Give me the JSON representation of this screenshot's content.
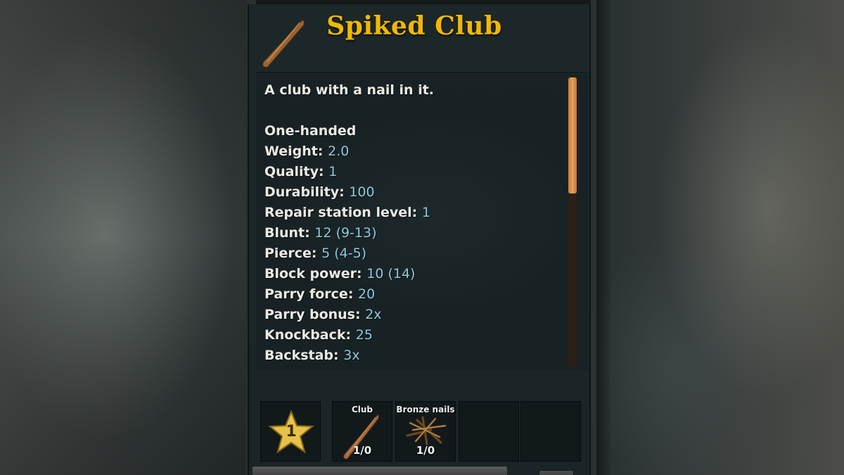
{
  "item": {
    "title": "Spiked Club",
    "icon": "club-icon"
  },
  "tooltip": {
    "description": "A club with a nail in it.",
    "handedness": "One-handed",
    "stats": [
      {
        "label": "Weight:",
        "value": "2.0"
      },
      {
        "label": "Quality:",
        "value": "1"
      },
      {
        "label": "Durability:",
        "value": "100"
      },
      {
        "label": "Repair station level:",
        "value": "1"
      },
      {
        "label": "Blunt:",
        "value": "12 (9-13)"
      },
      {
        "label": "Pierce:",
        "value": "5 (4-5)"
      },
      {
        "label": "Block power:",
        "value": "10 (14)"
      },
      {
        "label": "Parry force:",
        "value": "20"
      },
      {
        "label": "Parry bonus:",
        "value": "2x"
      },
      {
        "label": "Knockback:",
        "value": "25"
      },
      {
        "label": "Backstab:",
        "value": "3x"
      }
    ],
    "scroll_fraction": 0.4
  },
  "recipe": {
    "quality_level": "1",
    "quality_icon": "star-icon",
    "requirements": [
      {
        "name": "Club",
        "count": "1/0",
        "icon": "club-icon"
      },
      {
        "name": "Bronze nails",
        "count": "1/0",
        "icon": "bronze-nails-icon"
      }
    ]
  },
  "colors": {
    "title": "#f2b800",
    "stat_value": "#8fc9dc",
    "scroll_thumb": "#e6a05c"
  }
}
